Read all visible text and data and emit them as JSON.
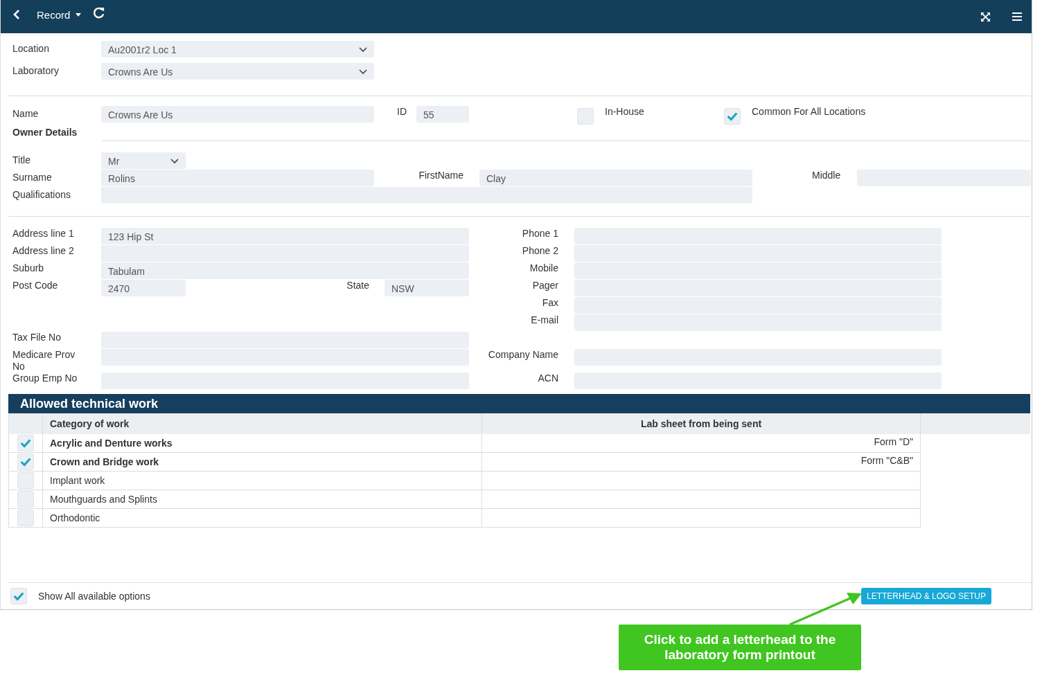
{
  "header": {
    "title": "Record"
  },
  "location": {
    "label": "Location",
    "value": "Au2001r2 Loc 1"
  },
  "laboratory": {
    "label": "Laboratory",
    "value": "Crowns Are Us"
  },
  "name": {
    "label": "Name",
    "value": "Crowns Are Us"
  },
  "id": {
    "label": "ID",
    "value": "55"
  },
  "in_house": {
    "label": "In-House",
    "checked": false
  },
  "common_for_all_locations": {
    "label": "Common For All Locations",
    "checked": true
  },
  "owner_details_heading": "Owner Details",
  "title": {
    "label": "Title",
    "value": "Mr"
  },
  "surname": {
    "label": "Surname",
    "value": "Rolins"
  },
  "firstname": {
    "label": "FirstName",
    "value": "Clay"
  },
  "middle": {
    "label": "Middle"
  },
  "qualifications": {
    "label": "Qualifications"
  },
  "contact_rows": [
    {
      "left": {
        "label": "Address line 1",
        "value": "123 Hip St"
      },
      "right": {
        "label": "Phone 1"
      }
    },
    {
      "left": {
        "label": "Address line 2"
      },
      "right": {
        "label": "Phone 2"
      }
    },
    {
      "left": {
        "label": "Suburb",
        "value": "Tabulam"
      },
      "right": {
        "label": "Mobile"
      }
    },
    {
      "left": {
        "label": "Post Code",
        "value": "2470",
        "state": {
          "label": "State",
          "value": "NSW"
        }
      },
      "right": {
        "label": "Pager"
      }
    },
    {
      "right": {
        "label": "Fax"
      }
    },
    {
      "right": {
        "label": "E-mail"
      }
    },
    {
      "left": {
        "label": "Tax File No"
      }
    },
    {
      "left": {
        "label": "Medicare Prov No"
      },
      "right": {
        "label": "Company Name"
      }
    },
    {
      "left": {
        "label": "Group Emp No"
      },
      "right": {
        "label": "ACN"
      }
    }
  ],
  "allowed_work": {
    "title": "Allowed technical work",
    "columns": [
      "Category of work",
      "Lab sheet from being sent"
    ],
    "rows": [
      {
        "checked": true,
        "category": "Acrylic and Denture works",
        "form": "Form \"D\""
      },
      {
        "checked": true,
        "category": "Crown and Bridge work",
        "form": "Form \"C&B\""
      },
      {
        "checked": false,
        "category": "Implant work"
      },
      {
        "checked": false,
        "category": "Mouthguards and Splints"
      },
      {
        "checked": false,
        "category": "Orthodontic"
      }
    ]
  },
  "show_all": {
    "label": "Show All available options",
    "checked": true
  },
  "letterhead_button": "LETTERHEAD & LOGO SETUP",
  "callout": "Click to add a letterhead to the laboratory form printout"
}
